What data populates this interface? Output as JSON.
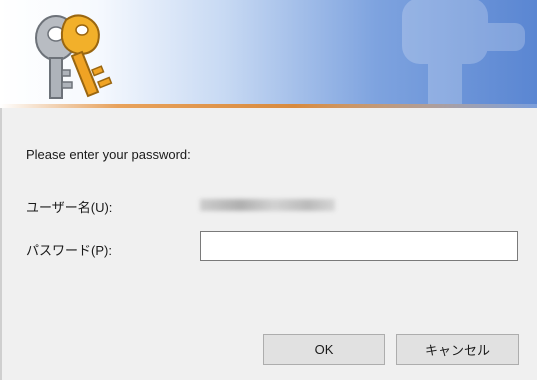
{
  "banner": {
    "icon": "keys-icon",
    "watermark_icon": "keys-watermark-icon"
  },
  "prompt": "Please enter your password:",
  "fields": {
    "username_label": "ユーザー名(U):",
    "username_value_hidden": true,
    "password_label": "パスワード(P):",
    "password_value": ""
  },
  "buttons": {
    "ok": "OK",
    "cancel": "キャンセル"
  },
  "colors": {
    "banner_accent": "#5a86d2",
    "divider": "#e8a25c",
    "background": "#f0f0f0"
  }
}
